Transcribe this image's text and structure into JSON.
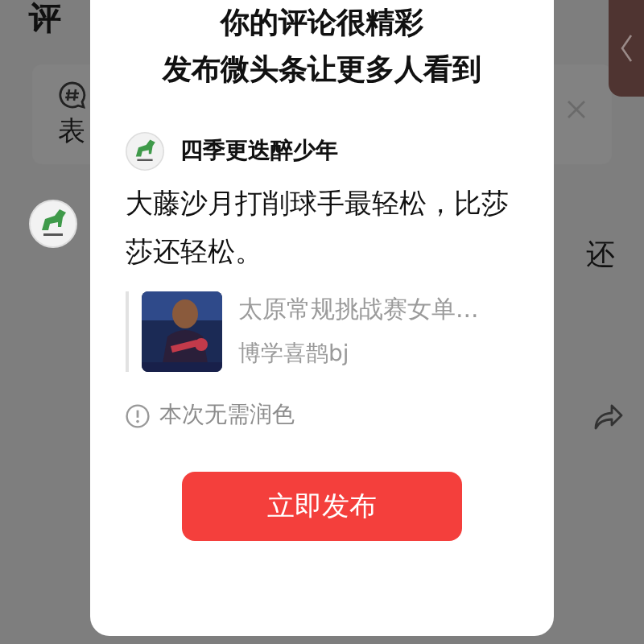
{
  "background_page": {
    "heading": "评",
    "topic_card": {
      "text": "表"
    },
    "comment": {
      "text": "还"
    }
  },
  "dialog": {
    "title_lines": [
      "你的评论很精彩",
      "发布微头条让更多人看到"
    ],
    "author": "四季更迭醉少年",
    "body": "大藤沙月打削球手最轻松，比莎莎还轻松。",
    "quote": {
      "title": "太原常规挑战赛女单...",
      "source": "博学喜鹊bj"
    },
    "notice": "本次无需润色",
    "publish_button": "立即发布"
  }
}
